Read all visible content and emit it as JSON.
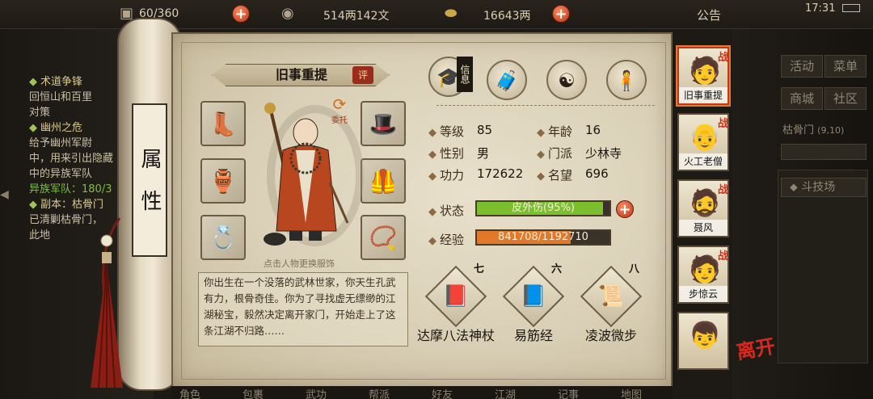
{
  "topbar": {
    "capacity": "60/360",
    "silver": "514两142文",
    "gold": "16643两",
    "notice": "公告",
    "clock": "17:31",
    "add_symbol": "+",
    "icons": [
      "bag-icon",
      "silver-coin-icon",
      "gold-ingot-icon",
      "battery-icon"
    ]
  },
  "quests": [
    {
      "title": "术道争锋",
      "lines": [
        "回恒山和百里",
        "对策"
      ]
    },
    {
      "title": "幽州之危",
      "lines": [
        "给予幽州军尉",
        "中，用来引出隐藏",
        "中的异族军队",
        "异族军队：180/3"
      ]
    },
    {
      "title": "副本：枯骨门",
      "lines": [
        "已清剿枯骨门，",
        "此地"
      ]
    }
  ],
  "scroll": {
    "title": "属性"
  },
  "character": {
    "name": "旧事重提",
    "rate": "评",
    "delegate": "委托",
    "hint": "点击人物更换服饰",
    "bio": "你出生在一个没落的武林世家，你天生孔武有力，根骨奇佳。你为了寻找虚无缥缈的江湖秘宝，毅然决定离开家门，开始走上了这条江湖不归路……"
  },
  "equipment": {
    "left": [
      {
        "icon": "boots-icon",
        "glyph": "👢"
      },
      {
        "icon": "amulet-icon",
        "glyph": "🏺"
      },
      {
        "icon": "ring-icon",
        "glyph": "💍"
      }
    ],
    "right": [
      {
        "icon": "hat-icon",
        "glyph": "🎩"
      },
      {
        "icon": "armor-icon",
        "glyph": "🦺"
      },
      {
        "icon": "prayer-beads-icon",
        "glyph": "📿"
      }
    ]
  },
  "tabs": [
    {
      "icon": "info-hat-icon",
      "glyph": "🎓",
      "tag": "信息"
    },
    {
      "icon": "bag-tab-icon",
      "glyph": "🧳"
    },
    {
      "icon": "yinyang-icon",
      "glyph": "☯"
    },
    {
      "icon": "body-icon",
      "glyph": "🧍"
    }
  ],
  "stats": {
    "level_label": "等级",
    "level": "85",
    "age_label": "年龄",
    "age": "16",
    "gender_label": "性别",
    "gender": "男",
    "sect_label": "门派",
    "sect": "少林寺",
    "power_label": "功力",
    "power": "172622",
    "fame_label": "名望",
    "fame": "696"
  },
  "status": {
    "label": "状态",
    "text": "皮外伤(95%)",
    "fraction": 0.95,
    "color": "#7bbf2f"
  },
  "exp": {
    "label": "经验",
    "text": "841708/1192710",
    "fraction": 0.706,
    "color": "#e07a2a"
  },
  "skills": [
    {
      "num": "七",
      "icon": "book-staff-icon",
      "glyph": "📕",
      "name": "达摩八法神杖"
    },
    {
      "num": "六",
      "icon": "book-blue-icon",
      "glyph": "📘",
      "name": "易筋经"
    },
    {
      "num": "八",
      "icon": "scroll-green-icon",
      "glyph": "📜",
      "name": "凌波微步"
    }
  ],
  "party": [
    {
      "name": "旧事重提",
      "glyph": "🧑",
      "war": "战",
      "selected": true
    },
    {
      "name": "火工老僧",
      "glyph": "👴",
      "war": "战",
      "selected": false
    },
    {
      "name": "聂风",
      "glyph": "🧔",
      "war": "战",
      "selected": false
    },
    {
      "name": "步惊云",
      "glyph": "🧑",
      "war": "战",
      "selected": false
    },
    {
      "name": "",
      "glyph": "👦",
      "war": "",
      "selected": false
    }
  ],
  "right_menu": {
    "buttons": [
      "活动",
      "菜单",
      "商城",
      "社区"
    ],
    "location": "枯骨门",
    "coords": "(9,10)",
    "arena": "斗技场"
  },
  "leave": "离开",
  "bottom_nav": [
    "角色",
    "包裹",
    "武功",
    "帮派",
    "好友",
    "江湖",
    "记事",
    "地图"
  ]
}
